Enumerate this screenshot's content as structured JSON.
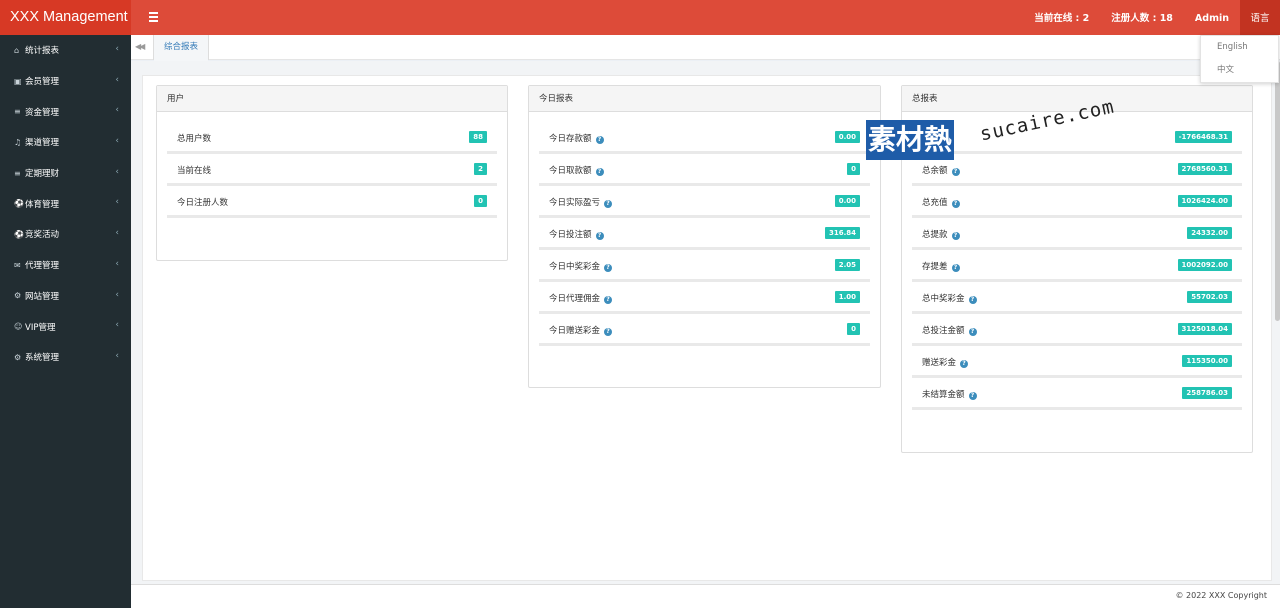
{
  "header": {
    "app_title": "XXX Management",
    "online_label": "当前在线 : 2",
    "registered_label": "注册人数 : 18",
    "user": "Admin",
    "language": "语言"
  },
  "language_menu": [
    "English",
    "中文"
  ],
  "sidebar": {
    "items": [
      {
        "label": "统计报表",
        "icon": "home-icon"
      },
      {
        "label": "会员管理",
        "icon": "user-card-icon"
      },
      {
        "label": "资金管理",
        "icon": "database-icon"
      },
      {
        "label": "渠道管理",
        "icon": "music-note-icon"
      },
      {
        "label": "定期理财",
        "icon": "database-icon"
      },
      {
        "label": "体育管理",
        "icon": "soccer-ball-icon"
      },
      {
        "label": "竞奖活动",
        "icon": "soccer-ball-icon"
      },
      {
        "label": "代理管理",
        "icon": "envelope-icon"
      },
      {
        "label": "网站管理",
        "icon": "cogs-icon"
      },
      {
        "label": "VIP管理",
        "icon": "user-outline-icon"
      },
      {
        "label": "系统管理",
        "icon": "gear-icon"
      }
    ]
  },
  "tabs": {
    "active": "综合报表"
  },
  "panels": {
    "users": {
      "title": "用户",
      "rows": [
        {
          "label": "总用户数",
          "value": "88"
        },
        {
          "label": "当前在线",
          "value": "2"
        },
        {
          "label": "今日注册人数",
          "value": "0"
        }
      ]
    },
    "today": {
      "title": "今日报表",
      "rows": [
        {
          "label": "今日存款额",
          "value": "0.00"
        },
        {
          "label": "今日取款额",
          "value": "0"
        },
        {
          "label": "今日实际盈亏",
          "value": "0.00"
        },
        {
          "label": "今日投注额",
          "value": "316.84"
        },
        {
          "label": "今日中奖彩金",
          "value": "2.05"
        },
        {
          "label": "今日代理佣金",
          "value": "1.00"
        },
        {
          "label": "今日赠送彩金",
          "value": "0"
        }
      ]
    },
    "total": {
      "title": "总报表",
      "rows": [
        {
          "label": "",
          "value": "-1766468.31"
        },
        {
          "label": "总余额",
          "value": "2768560.31"
        },
        {
          "label": "总充值",
          "value": "1026424.00"
        },
        {
          "label": "总提款",
          "value": "24332.00"
        },
        {
          "label": "存提差",
          "value": "1002092.00"
        },
        {
          "label": "总中奖彩金",
          "value": "55702.03"
        },
        {
          "label": "总投注金额",
          "value": "3125018.04"
        },
        {
          "label": "赠送彩金",
          "value": "115350.00"
        },
        {
          "label": "未结算金额",
          "value": "258786.03"
        }
      ]
    }
  },
  "footer": {
    "copyright": "© 2022 XXX Copyright"
  },
  "watermark": {
    "cn": "素材熱",
    "en": "sucaire.com"
  },
  "colors": {
    "header": "#dd4b39",
    "logo_bg": "#d73925",
    "sidebar": "#222d32",
    "badge": "#22c3b3",
    "help_icon": "#3c8dbc"
  }
}
